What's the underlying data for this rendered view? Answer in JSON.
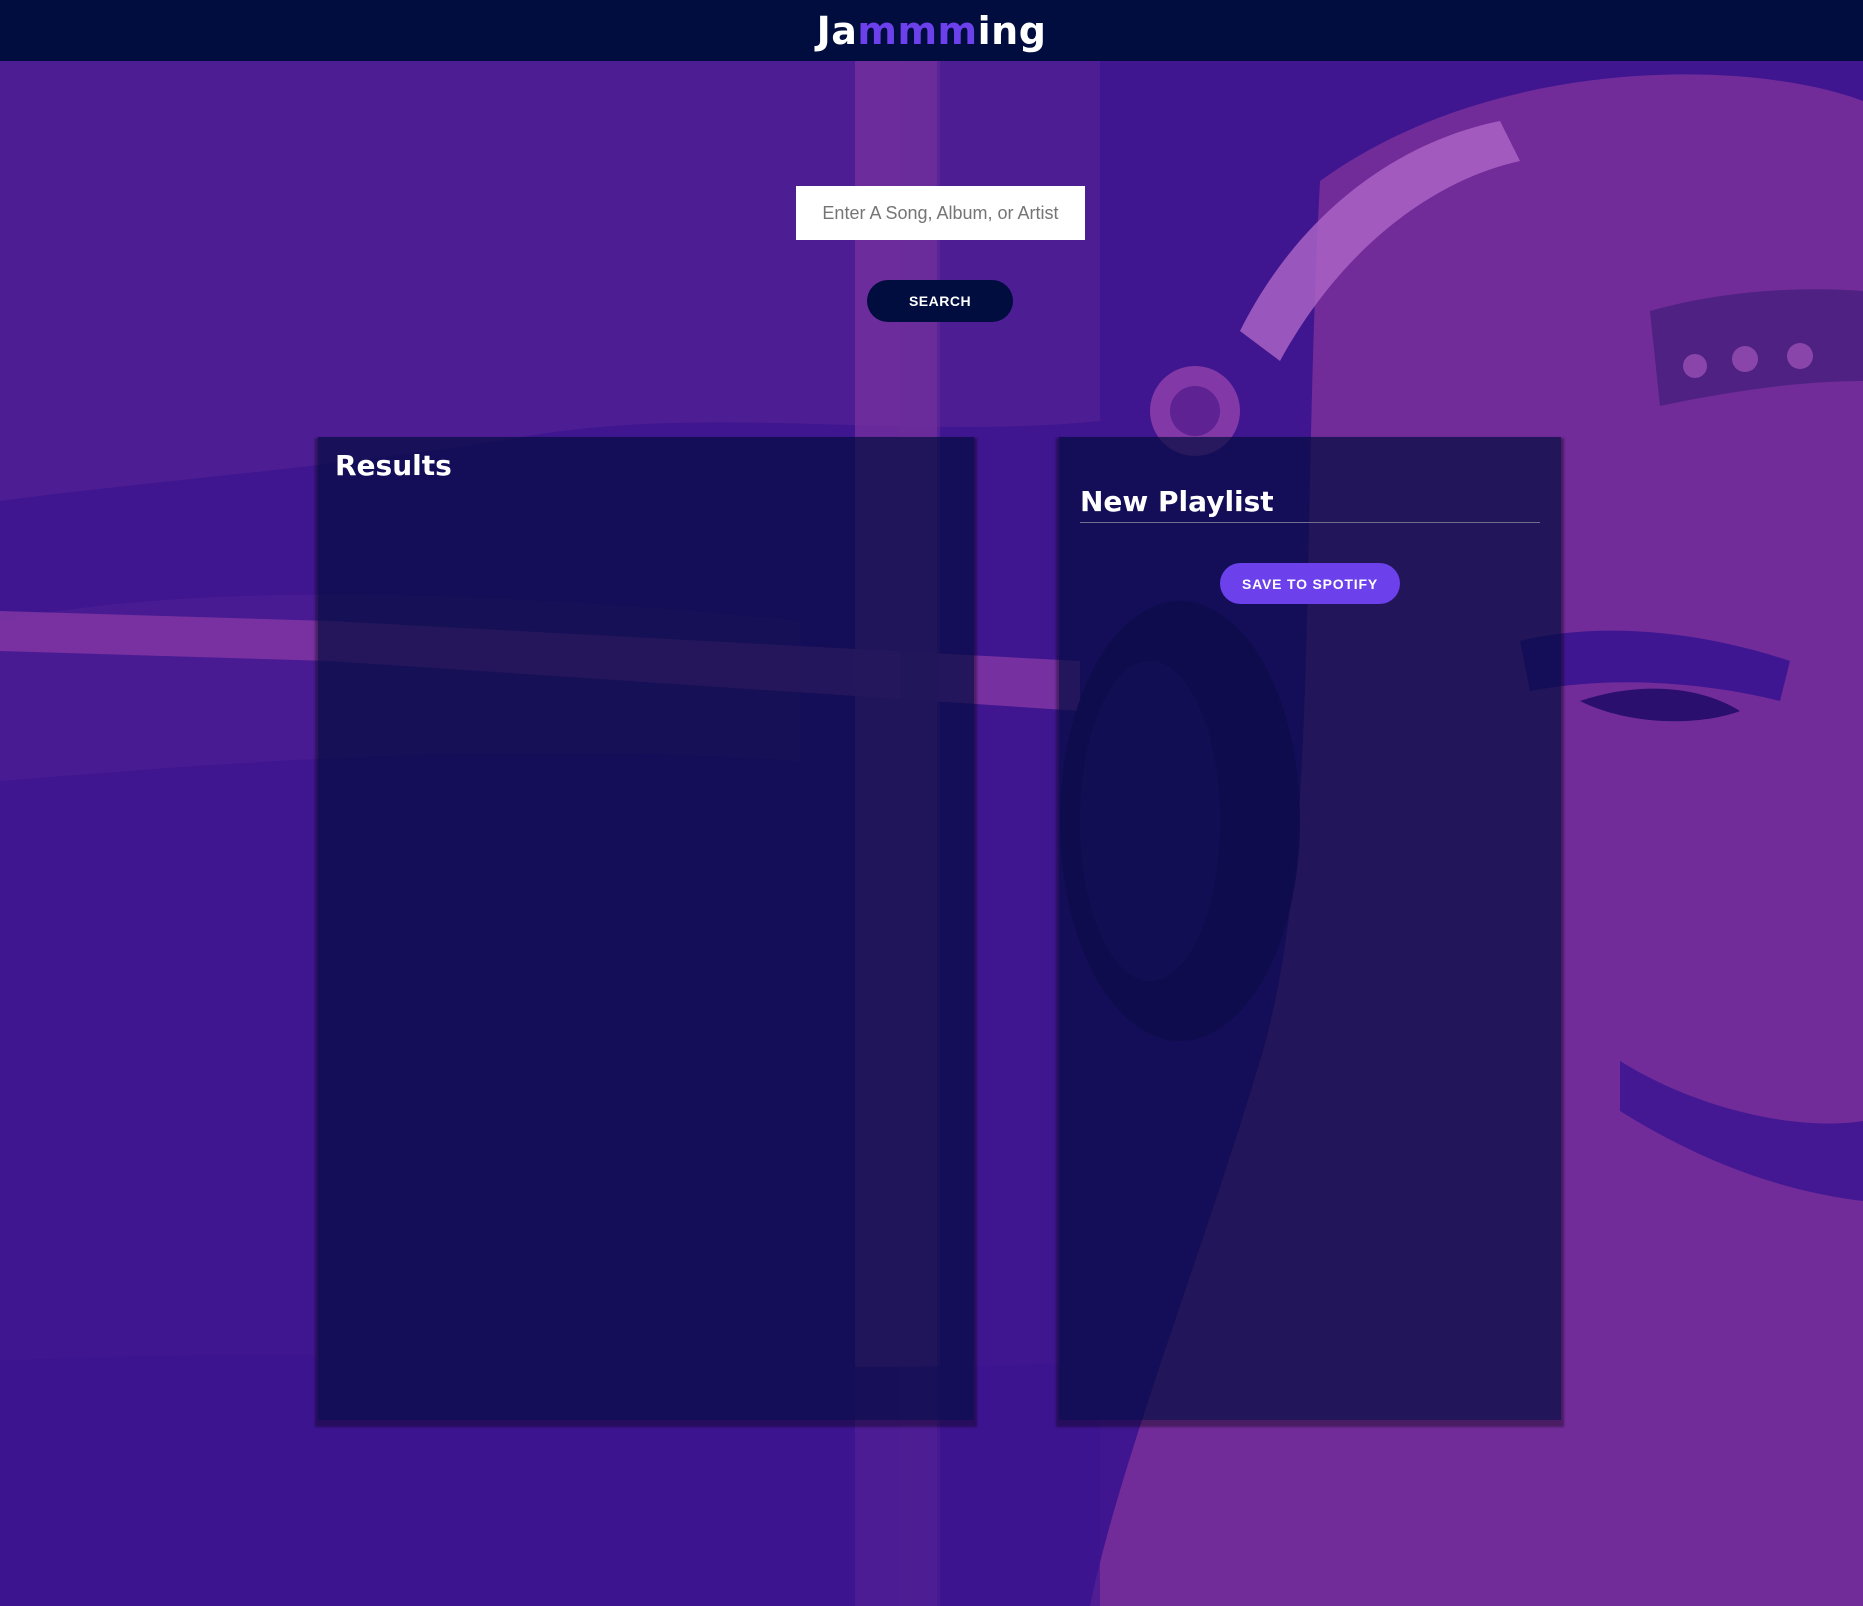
{
  "header": {
    "logo_part1": "Ja",
    "logo_part2": "mmm",
    "logo_part3": "ing"
  },
  "search": {
    "placeholder": "Enter A Song, Album, or Artist",
    "value": "",
    "button_label": "SEARCH"
  },
  "results": {
    "title": "Results",
    "tracks": []
  },
  "playlist": {
    "name": "New Playlist",
    "tracks": [],
    "save_label": "SAVE TO SPOTIFY"
  },
  "colors": {
    "header_bg": "#010c3f",
    "accent": "#6c41ec",
    "background": "#3a1490",
    "panel_bg": "rgba(1,12,63,0.7)"
  },
  "icons": {
    "background": "headphones-man-photo"
  }
}
